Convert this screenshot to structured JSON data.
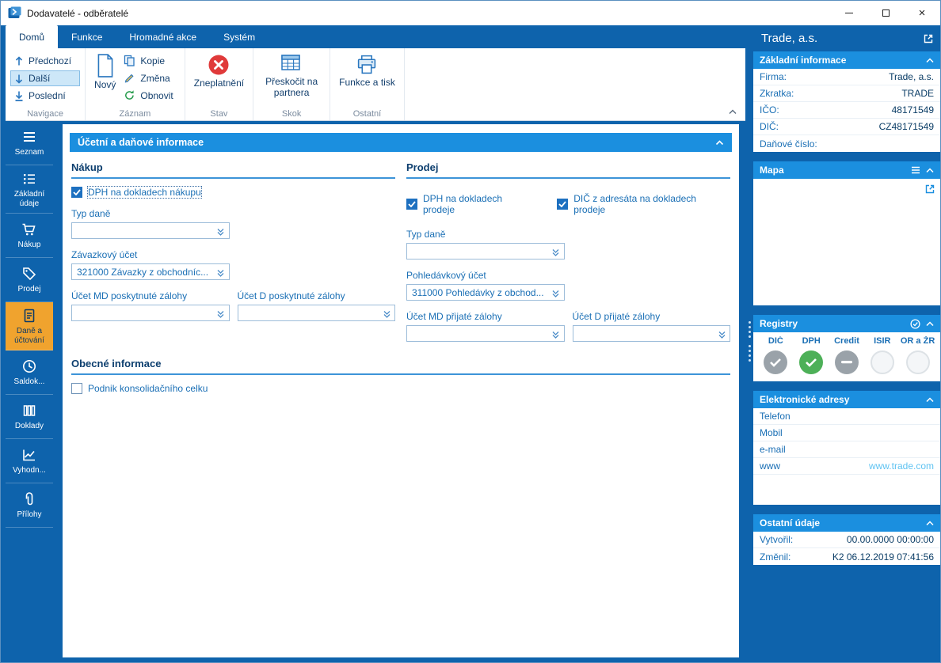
{
  "colors": {
    "chrome_blue": "#0e63ac",
    "header_blue": "#1b8fdf",
    "label_blue": "#1a6fb5",
    "navy": "#0c3e6e",
    "active_orange": "#f0a32e",
    "status_green": "#4db058",
    "status_gray": "#9aa2a9",
    "link_light_blue": "#5fc3f2",
    "invalid_red": "#e03a3a"
  },
  "window": {
    "title": "Dodavatelé - odběratelé"
  },
  "ribbon": {
    "tabs": [
      {
        "label": "Domů",
        "active": true
      },
      {
        "label": "Funkce",
        "active": false
      },
      {
        "label": "Hromadné akce",
        "active": false
      },
      {
        "label": "Systém",
        "active": false
      }
    ],
    "navigace": {
      "group_label": "Navigace",
      "items": [
        {
          "label": "Předchozí",
          "icon": "arrow-up-icon",
          "selected": false
        },
        {
          "label": "Další",
          "icon": "arrow-down-icon",
          "selected": true
        },
        {
          "label": "Poslední",
          "icon": "arrow-down-bar-icon",
          "selected": false
        }
      ]
    },
    "zaznam": {
      "group_label": "Záznam",
      "big_button": {
        "label": "Nový",
        "icon": "new-document-icon"
      },
      "items": [
        {
          "label": "Kopie",
          "icon": "copy-icon"
        },
        {
          "label": "Změna",
          "icon": "pencil-icon"
        },
        {
          "label": "Obnovit",
          "icon": "refresh-icon"
        }
      ]
    },
    "stav": {
      "group_label": "Stav",
      "big_button": {
        "label": "Zneplatnění",
        "icon": "red-cross-circle-icon"
      }
    },
    "skok": {
      "group_label": "Skok",
      "big_button": {
        "label": "Přeskočit na partnera",
        "icon": "table-jump-icon"
      }
    },
    "ostatni": {
      "group_label": "Ostatní",
      "big_button": {
        "label": "Funkce a tisk",
        "icon": "printer-icon"
      }
    }
  },
  "sidebar": {
    "items": [
      {
        "label": "Seznam",
        "icon": "menu-icon",
        "active": false
      },
      {
        "label": "Základní údaje",
        "icon": "list-icon",
        "active": false
      },
      {
        "label": "Nákup",
        "icon": "cart-icon",
        "active": false
      },
      {
        "label": "Prodej",
        "icon": "tag-icon",
        "active": false
      },
      {
        "label": "Daně a účtování",
        "icon": "invoice-icon",
        "active": true
      },
      {
        "label": "Saldok...",
        "icon": "clock-icon",
        "active": false
      },
      {
        "label": "Doklady",
        "icon": "columns-icon",
        "active": false
      },
      {
        "label": "Vyhodn...",
        "icon": "chart-icon",
        "active": false
      },
      {
        "label": "Přílohy",
        "icon": "paperclip-icon",
        "active": false
      }
    ]
  },
  "main": {
    "panel_title": "Účetní a daňové informace",
    "nakup": {
      "title": "Nákup",
      "checkboxes": [
        {
          "label": "DPH na dokladech nákupu",
          "checked": true
        }
      ],
      "typ_dane": {
        "label": "Typ daně",
        "value": ""
      },
      "ucet": {
        "label": "Závazkový účet",
        "value": "321000 Závazky z obchodníc..."
      },
      "zaloha_md": {
        "label": "Účet MD poskytnuté zálohy",
        "value": ""
      },
      "zaloha_d": {
        "label": "Účet D poskytnuté zálohy",
        "value": ""
      }
    },
    "prodej": {
      "title": "Prodej",
      "checkboxes": [
        {
          "label": "DPH na dokladech prodeje",
          "checked": true
        },
        {
          "label": "DIČ z adresáta na dokladech prodeje",
          "checked": true
        }
      ],
      "typ_dane": {
        "label": "Typ daně",
        "value": ""
      },
      "ucet": {
        "label": "Pohledávkový účet",
        "value": "311000 Pohledávky z obchod..."
      },
      "zaloha_md": {
        "label": "Účet MD přijaté zálohy",
        "value": ""
      },
      "zaloha_d": {
        "label": "Účet D přijaté zálohy",
        "value": ""
      }
    },
    "obecne": {
      "title": "Obecné informace",
      "checkboxes": [
        {
          "label": "Podnik konsolidačního celku",
          "checked": false
        }
      ]
    }
  },
  "right_panel": {
    "title": "Trade, a.s.",
    "zakladni": {
      "title": "Základní informace",
      "rows": [
        {
          "label": "Firma:",
          "value": "Trade, a.s."
        },
        {
          "label": "Zkratka:",
          "value": "TRADE"
        },
        {
          "label": "IČO:",
          "value": "48171549"
        },
        {
          "label": "DIČ:",
          "value": "CZ48171549"
        },
        {
          "label": "Daňové číslo:",
          "value": ""
        }
      ]
    },
    "mapa": {
      "title": "Mapa"
    },
    "registry": {
      "title": "Registry",
      "columns": [
        "DIČ",
        "DPH",
        "Credit",
        "ISIR",
        "OR a ŽR"
      ],
      "statuses": [
        "check-gray",
        "check-green",
        "dash-gray",
        "empty",
        "empty"
      ]
    },
    "adresy": {
      "title": "Elektronické adresy",
      "rows": [
        {
          "label": "Telefon",
          "value": ""
        },
        {
          "label": "Mobil",
          "value": ""
        },
        {
          "label": "e-mail",
          "value": ""
        },
        {
          "label": "www",
          "value": "www.trade.com",
          "link": true
        }
      ]
    },
    "ostatni": {
      "title": "Ostatní údaje",
      "rows": [
        {
          "label": "Vytvořil:",
          "value": "00.00.0000 00:00:00"
        },
        {
          "label": "Změnil:",
          "value": "K2 06.12.2019 07:41:56"
        }
      ]
    }
  }
}
